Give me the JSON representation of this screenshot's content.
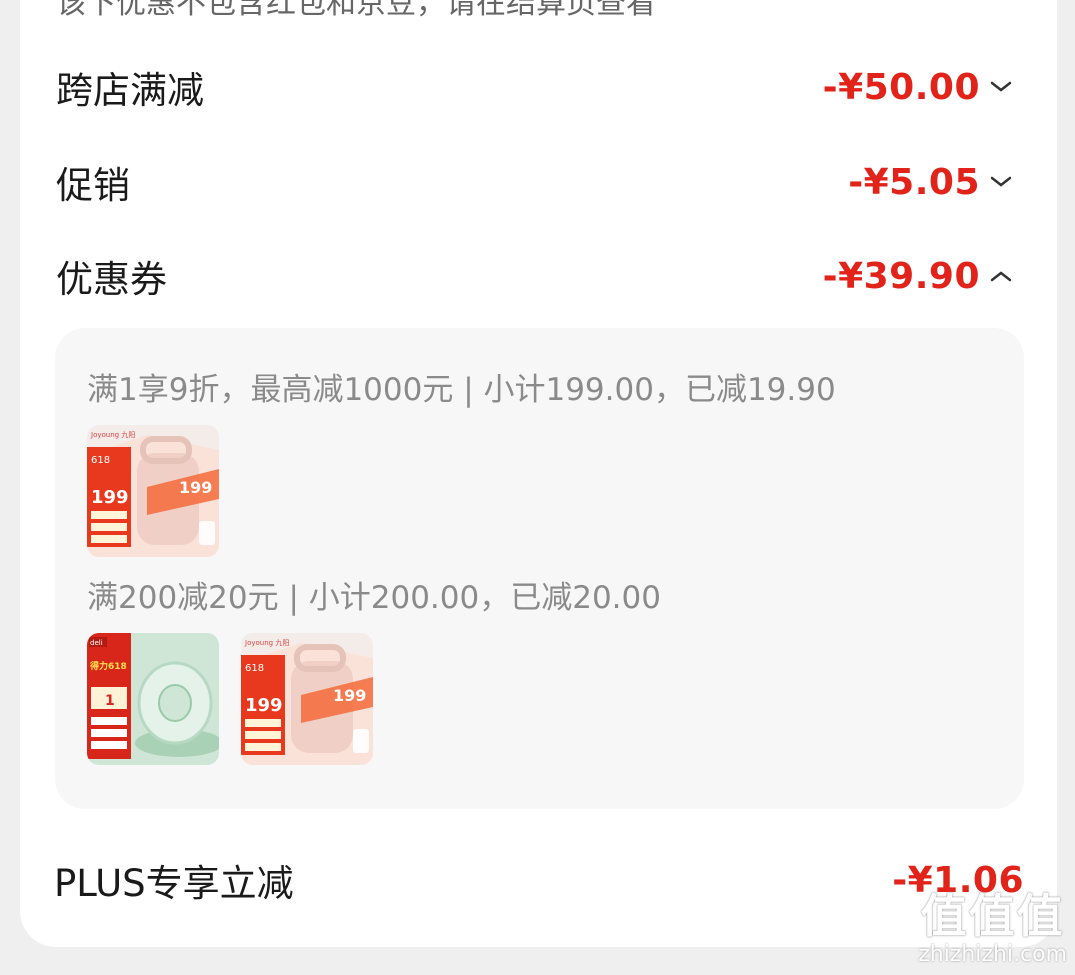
{
  "top_note": "该下优惠不包含红包和京豆，请在结算页查看",
  "rows": [
    {
      "label": "跨店满减",
      "amount": "-¥50.00",
      "expanded": false
    },
    {
      "label": "促销",
      "amount": "-¥5.05",
      "expanded": false
    },
    {
      "label": "优惠券",
      "amount": "-¥39.90",
      "expanded": true
    }
  ],
  "coupons": [
    {
      "rule": "满1享9折，最高减1000元 | 小计199.00，已减19.90",
      "products": [
        {
          "brand": "Joyoung 九阳",
          "badge": "618",
          "price": "199",
          "icon": "soymilk-maker-product-icon"
        }
      ]
    },
    {
      "rule": "满200减20元 | 小计200.00，已减20.00",
      "products": [
        {
          "brand": "deli",
          "badge": "得力618",
          "price": "1",
          "icon": "tape-roll-product-icon"
        },
        {
          "brand": "Joyoung 九阳",
          "badge": "618",
          "price": "199",
          "icon": "soymilk-maker-product-icon"
        }
      ]
    }
  ],
  "plus": {
    "label": "PLUS专享立减",
    "amount": "-¥1.06"
  },
  "watermark": {
    "glyphs": "值值值",
    "url": "zhizhizhi.com"
  },
  "colors": {
    "accent": "#e2231a",
    "panel": "#f7f7f7"
  }
}
